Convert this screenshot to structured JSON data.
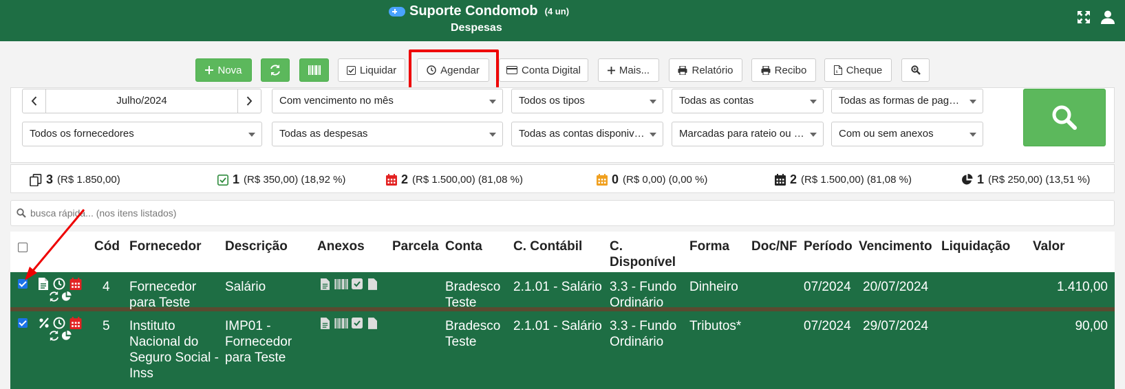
{
  "header": {
    "app_name": "Suporte Condomob",
    "unit_count": "(4 un)",
    "page": "Despesas",
    "icons": [
      "gamepad-icon",
      "expand-icon",
      "user-icon"
    ]
  },
  "toolbar": {
    "nova": "Nova",
    "liquidar": "Liquidar",
    "agendar": "Agendar",
    "conta_digital": "Conta Digital",
    "mais": "Mais...",
    "relatorio": "Relatório",
    "recibo": "Recibo",
    "cheque": "Cheque"
  },
  "filters": {
    "month": "Julho/2024",
    "vencimento": "Com vencimento no mês",
    "tipos": "Todos os tipos",
    "contas": "Todas as contas",
    "formas": "Todas as formas de pagamento",
    "fornecedores": "Todos os fornecedores",
    "despesas": "Todas as despesas",
    "contas_disponiveis": "Todas as contas disponiveis",
    "rateio": "Marcadas para rateio ou não",
    "anexos": "Com ou sem anexos"
  },
  "stats": [
    {
      "icon": "copy-icon",
      "count": "3",
      "detail": "(R$ 1.850,00)",
      "color": "#222222"
    },
    {
      "icon": "check-square-icon",
      "count": "1",
      "detail": "(R$ 350,00) (18,92 %)",
      "color": "#2e8b3c"
    },
    {
      "icon": "calendar-icon",
      "count": "2",
      "detail": "(R$ 1.500,00) (81,08 %)",
      "color": "#e32222"
    },
    {
      "icon": "calendar-icon",
      "count": "0",
      "detail": "(R$ 0,00) (0,00 %)",
      "color": "#f0a020"
    },
    {
      "icon": "calendar-icon",
      "count": "2",
      "detail": "(R$ 1.500,00) (81,08 %)",
      "color": "#222222"
    },
    {
      "icon": "pie-chart-icon",
      "count": "1",
      "detail": "(R$ 250,00) (13,51 %)",
      "color": "#222222"
    }
  ],
  "quick_search": {
    "placeholder": "busca rápida... (nos itens listados)"
  },
  "table": {
    "headers": {
      "cod": "Cód",
      "fornecedor": "Fornecedor",
      "descricao": "Descrição",
      "anexos": "Anexos",
      "parcela": "Parcela",
      "conta": "Conta",
      "contabil": "C. Contábil",
      "disponivel_1": "C.",
      "disponivel_2": "Disponível",
      "forma": "Forma",
      "doc": "Doc/NF",
      "periodo": "Período",
      "vencimento": "Vencimento",
      "liquidacao": "Liquidação",
      "valor": "Valor"
    },
    "rows": [
      {
        "cod": "4",
        "fornecedor_1": "Fornecedor",
        "fornecedor_2": "para Teste",
        "descricao_1": "Salário",
        "conta_1": "Bradesco",
        "conta_2": "Teste",
        "contabil": "2.1.01 - Salário",
        "disponivel_1": "3.3 - Fundo",
        "disponivel_2": "Ordinário",
        "forma": "Dinheiro",
        "periodo": "07/2024",
        "vencimento": "20/07/2024",
        "valor": "1.410,00"
      },
      {
        "cod": "5",
        "fornecedor_1": "Instituto",
        "fornecedor_2": "Nacional do",
        "fornecedor_3": "Seguro Social -",
        "fornecedor_4": "Inss",
        "descricao_1": "IMP01 -",
        "descricao_2": "Fornecedor",
        "descricao_3": "para Teste",
        "conta_1": "Bradesco",
        "conta_2": "Teste",
        "contabil": "2.1.01 - Salário",
        "disponivel_1": "3.3 - Fundo",
        "disponivel_2": "Ordinário",
        "forma": "Tributos*",
        "periodo": "07/2024",
        "vencimento": "29/07/2024",
        "valor": "90,00"
      }
    ]
  },
  "colors": {
    "header_green": "#1e6e44",
    "button_green": "#5cb85c",
    "highlight_red": "#e00000",
    "checkbox_blue": "#1a73e8"
  }
}
